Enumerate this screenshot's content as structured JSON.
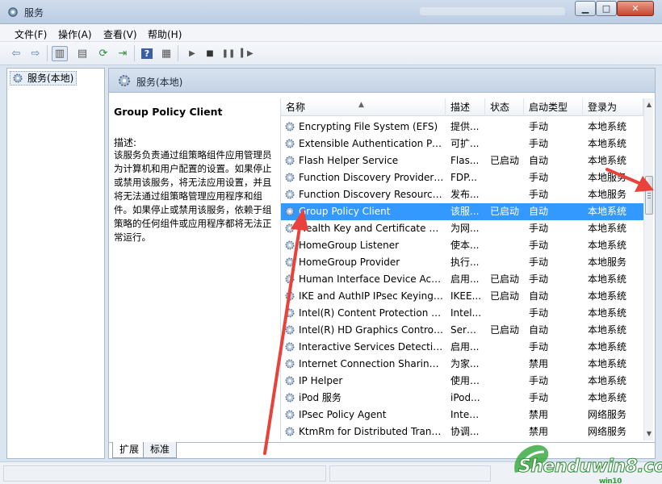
{
  "window": {
    "title": "服务"
  },
  "menu": [
    "文件(F)",
    "操作(A)",
    "查看(V)",
    "帮助(H)"
  ],
  "tree": {
    "root_label": "服务(本地)"
  },
  "main": {
    "header_title": "服务(本地)",
    "selected_service": "Group Policy Client",
    "description_label": "描述:",
    "description": "该服务负责通过组策略组件应用管理员为计算机和用户配置的设置。如果停止或禁用该服务，将无法应用设置，并且将无法通过组策略管理应用程序和组件。如果停止或禁用该服务，依赖于组策略的任何组件或应用程序都将无法正常运行。"
  },
  "columns": {
    "name": "名称",
    "desc": "描述",
    "status": "状态",
    "startup": "启动类型",
    "logon": "登录为"
  },
  "services": [
    {
      "name": "Encrypting File System (EFS)",
      "desc": "提供...",
      "status": "",
      "startup": "手动",
      "logon": "本地系统"
    },
    {
      "name": "Extensible Authentication Pro...",
      "desc": "可扩...",
      "status": "",
      "startup": "手动",
      "logon": "本地系统"
    },
    {
      "name": "Flash Helper Service",
      "desc": "Flas...",
      "status": "已启动",
      "startup": "自动",
      "logon": "本地系统"
    },
    {
      "name": "Function Discovery Provider ...",
      "desc": "FDP...",
      "status": "",
      "startup": "手动",
      "logon": "本地服务"
    },
    {
      "name": "Function Discovery Resource ...",
      "desc": "发布...",
      "status": "",
      "startup": "手动",
      "logon": "本地服务"
    },
    {
      "name": "Group Policy Client",
      "desc": "该服...",
      "status": "已启动",
      "startup": "自动",
      "logon": "本地系统"
    },
    {
      "name": "Health Key and Certificate M...",
      "desc": "为网...",
      "status": "",
      "startup": "手动",
      "logon": "本地系统"
    },
    {
      "name": "HomeGroup Listener",
      "desc": "使本...",
      "status": "",
      "startup": "手动",
      "logon": "本地系统"
    },
    {
      "name": "HomeGroup Provider",
      "desc": "执行...",
      "status": "",
      "startup": "手动",
      "logon": "本地服务"
    },
    {
      "name": "Human Interface Device Acce...",
      "desc": "启用...",
      "status": "已启动",
      "startup": "手动",
      "logon": "本地系统"
    },
    {
      "name": "IKE and AuthIP IPsec Keying ...",
      "desc": "IKEE...",
      "status": "已启动",
      "startup": "自动",
      "logon": "本地系统"
    },
    {
      "name": "Intel(R) Content Protection H...",
      "desc": "Intel...",
      "status": "",
      "startup": "手动",
      "logon": "本地系统"
    },
    {
      "name": "Intel(R) HD Graphics Control ...",
      "desc": "Servi...",
      "status": "已启动",
      "startup": "自动",
      "logon": "本地系统"
    },
    {
      "name": "Interactive Services Detection",
      "desc": "启用...",
      "status": "",
      "startup": "手动",
      "logon": "本地系统"
    },
    {
      "name": "Internet Connection Sharing (...",
      "desc": "为家...",
      "status": "",
      "startup": "禁用",
      "logon": "本地系统"
    },
    {
      "name": "IP Helper",
      "desc": "使用 ...",
      "status": "",
      "startup": "手动",
      "logon": "本地系统"
    },
    {
      "name": "iPod 服务",
      "desc": "iPod...",
      "status": "",
      "startup": "手动",
      "logon": "本地系统"
    },
    {
      "name": "IPsec Policy Agent",
      "desc": "Inter...",
      "status": "",
      "startup": "禁用",
      "logon": "网络服务"
    },
    {
      "name": "KtmRm for Distributed Trans...",
      "desc": "协调...",
      "status": "",
      "startup": "禁用",
      "logon": "网络服务"
    }
  ],
  "tabs": [
    "扩展",
    "标准"
  ],
  "watermark": {
    "brand": "Shenduwin8.com",
    "sub": "win10"
  },
  "colors": {
    "selection": "#3399ff",
    "annotation_arrow": "#e8423a"
  }
}
